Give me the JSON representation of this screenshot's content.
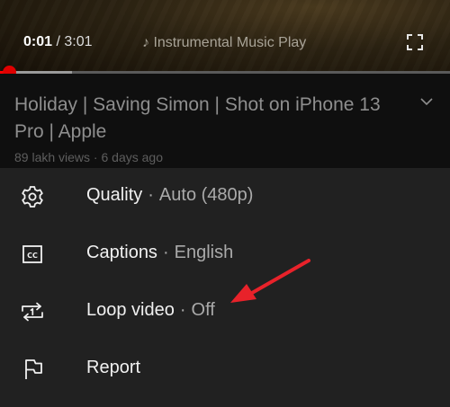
{
  "player": {
    "current_time": "0:01",
    "separator": " / ",
    "duration": "3:01",
    "music_label": "♪ Instrumental Music Play",
    "progress_played": 0.005,
    "progress_buffered": 0.16
  },
  "video": {
    "title": "Holiday | Saving Simon | Shot on iPhone 13 Pro | Apple",
    "meta": "89 lakh views · 6 days ago"
  },
  "menu": {
    "items": [
      {
        "label": "Quality",
        "value": "Auto (480p)",
        "icon": "gear-icon"
      },
      {
        "label": "Captions",
        "value": "English",
        "icon": "cc-icon"
      },
      {
        "label": "Loop video",
        "value": "Off",
        "icon": "loop-icon"
      },
      {
        "label": "Report",
        "value": "",
        "icon": "flag-icon"
      }
    ],
    "separator": "·"
  },
  "colors": {
    "sheet_bg": "#212121",
    "info_bg": "#0f0f0f",
    "progress_red": "#ff0000",
    "annotation_arrow": "#e8222a"
  }
}
